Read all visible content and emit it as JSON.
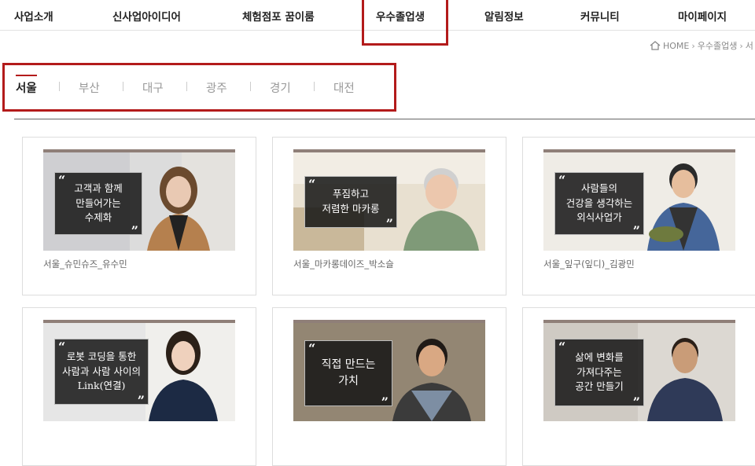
{
  "nav": {
    "items": [
      "사업소개",
      "신사업아이디어",
      "체험점포 꿈이룸",
      "우수졸업생",
      "알림정보",
      "커뮤니티",
      "마이페이지"
    ]
  },
  "breadcrumb": {
    "home": "HOME",
    "current": "우수졸업생",
    "trail": "서"
  },
  "regions": {
    "tabs": [
      "서울",
      "부산",
      "대구",
      "광주",
      "경기",
      "대전"
    ],
    "active": "서울"
  },
  "cards": [
    {
      "quote": "고객과 함께\n만들어가는\n수제화",
      "caption": "서울_슈민슈즈_유수민"
    },
    {
      "quote": "푸짐하고\n저렴한 마카롱",
      "caption": "서울_마카롱데이즈_박소슬"
    },
    {
      "quote": "사람들의\n건강을 생각하는\n외식사업가",
      "caption": "서울_잎구(잎디)_김광민"
    },
    {
      "quote": "로봇 코딩을 통한\n사람과 사람 사이의\nLink(연결)",
      "caption": ""
    },
    {
      "quote": "직접 만드는\n가치",
      "caption": ""
    },
    {
      "quote": "삶에 변화를\n가져다주는\n공간 만들기",
      "caption": ""
    }
  ],
  "colors": {
    "accent": "#b31b1b",
    "thumb_bar": "#8f7f78"
  }
}
